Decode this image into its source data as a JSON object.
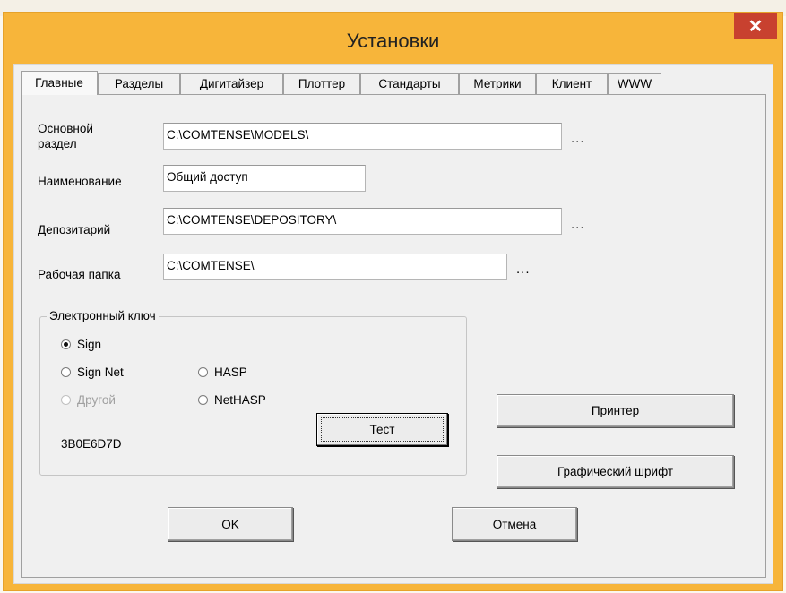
{
  "window": {
    "title": "Установки",
    "close_label": "✕"
  },
  "tabs": [
    {
      "label": "Главные",
      "active": true
    },
    {
      "label": "Разделы"
    },
    {
      "label": "Дигитайзер"
    },
    {
      "label": "Плоттер"
    },
    {
      "label": "Стандарты"
    },
    {
      "label": "Метрики"
    },
    {
      "label": "Клиент"
    },
    {
      "label": "WWW"
    }
  ],
  "fields": {
    "main_section": {
      "label_line1": "Основной",
      "label_line2": "раздел",
      "value": "C:\\COMTENSE\\MODELS\\",
      "browse": "..."
    },
    "name": {
      "label": "Наименование",
      "value": "Общий доступ"
    },
    "depository": {
      "label": "Депозитарий",
      "value": "C:\\COMTENSE\\DEPOSITORY\\",
      "browse": "..."
    },
    "work_folder": {
      "label": "Рабочая папка",
      "value": "C:\\COMTENSE\\",
      "browse": "..."
    }
  },
  "electronic_key": {
    "title": "Электронный ключ",
    "options": {
      "sign": "Sign",
      "sign_net": "Sign Net",
      "hasp": "HASP",
      "other": "Другой",
      "nethasp": "NetHASP"
    },
    "selected": "Sign",
    "key_code": "3B0E6D7D",
    "test_button": "Тест"
  },
  "buttons": {
    "printer": "Принтер",
    "graphic_font": "Графический шрифт",
    "ok": "OK",
    "cancel": "Отмена"
  },
  "colors": {
    "title_bar": "#f7b53a",
    "close_button": "#c8412f",
    "dialog_bg": "#f0f0f0"
  }
}
